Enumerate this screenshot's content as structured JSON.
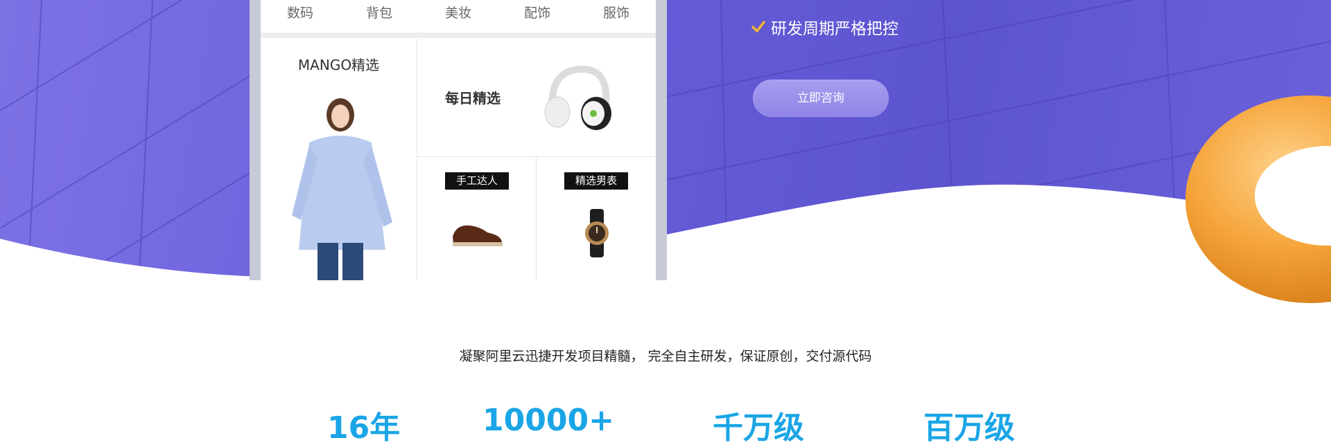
{
  "phone": {
    "categories": [
      "数码",
      "背包",
      "美妆",
      "配饰",
      "服饰"
    ],
    "tiles": {
      "left_title": "MANGO精选",
      "daily_title": "每日精选",
      "handmade_tag": "手工达人",
      "watch_tag": "精选男表"
    }
  },
  "features": {
    "item": "研发周期严格把控"
  },
  "cta": {
    "label": "立即咨询"
  },
  "intro": {
    "subtitle": "凝聚阿里云迅捷开发项目精髓，  完全自主研发，保证原创，交付源代码"
  },
  "stats": [
    {
      "value": "16年"
    },
    {
      "value": "10000+"
    },
    {
      "value": "千万级"
    },
    {
      "value": "百万级"
    }
  ],
  "colors": {
    "hero_purple": "#6a5fdc",
    "accent_blue": "#1aa5e6",
    "donut_orange": "#f5a43a",
    "check_gold": "#f2b534"
  }
}
